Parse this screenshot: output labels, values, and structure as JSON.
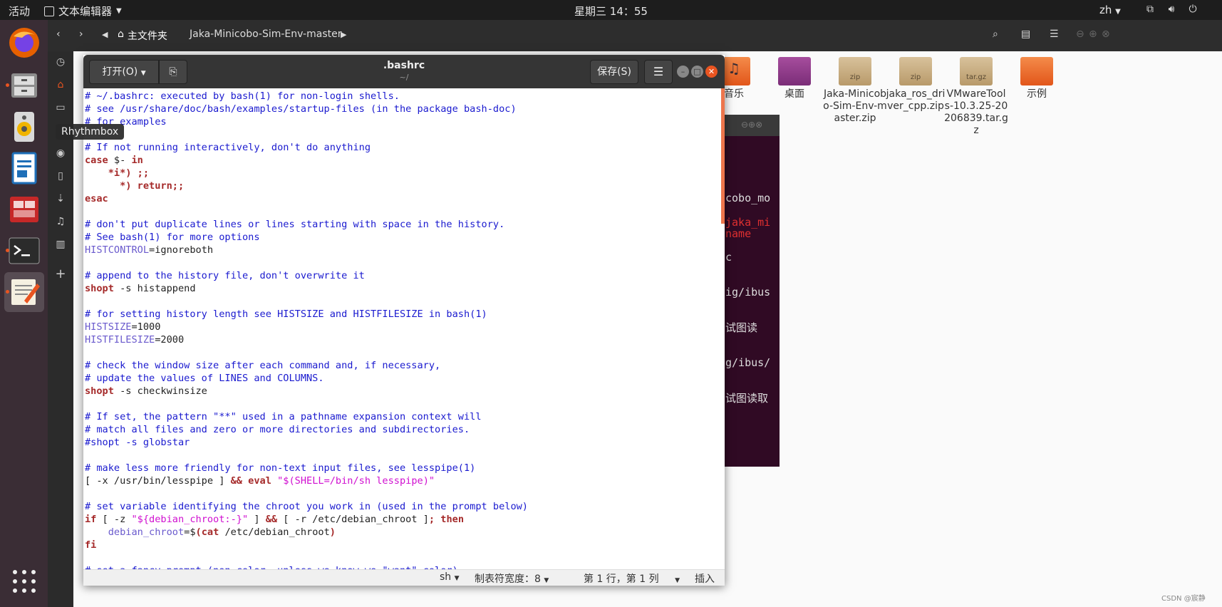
{
  "topbar": {
    "activities": "活动",
    "app_menu": "文本编辑器",
    "clock": "星期三 14：55",
    "lang": "zh"
  },
  "dock": {
    "tooltip": "Rhythmbox"
  },
  "files": {
    "home_label": "主文件夹",
    "path_segment": "Jaka-Minicobo-Sim-Env-master",
    "items": [
      {
        "label": "音乐",
        "icon": "music-folder-icon"
      },
      {
        "label": "桌面",
        "icon": "desktop-folder-icon"
      },
      {
        "label": "Jaka-Minicobo-Sim-Env-master.zip",
        "icon": "zip-icon",
        "badge": "zip"
      },
      {
        "label": "jaka_ros_driver_cpp.zip",
        "icon": "zip-icon",
        "badge": "zip"
      },
      {
        "label": "VMwareTools-10.3.25-20206839.tar.gz",
        "icon": "tar-icon",
        "badge": "tar.gz"
      },
      {
        "label": "示例",
        "icon": "examples-folder-icon"
      }
    ]
  },
  "bg_terminal": {
    "lines": [
      "cobo_mo",
      "jaka_mi",
      "name",
      "c",
      "ig/ibus",
      "试图读",
      "g/ibus/",
      "试图读取"
    ]
  },
  "gedit": {
    "open_label": "打开(O)",
    "title": ".bashrc",
    "subtitle": "~/",
    "save_label": "保存(S)",
    "status": {
      "language": "sh",
      "tab_width": "制表符宽度：8",
      "position": "第 1 行，第 1 列",
      "mode": "插入"
    }
  },
  "code_lines": [
    [
      {
        "t": "# ~/.bashrc: executed by bash(1) for non-login shells.",
        "c": "comment"
      }
    ],
    [
      {
        "t": "# see /usr/share/doc/bash/examples/startup-files (in the package bash-doc)",
        "c": "comment"
      }
    ],
    [
      {
        "t": "# for examples",
        "c": "comment"
      }
    ],
    [],
    [
      {
        "t": "# If not running interactively, don't do anything",
        "c": "comment"
      }
    ],
    [
      {
        "t": "case",
        "c": "kw"
      },
      {
        "t": " $- "
      },
      {
        "t": "in",
        "c": "kw"
      }
    ],
    [
      {
        "t": "    "
      },
      {
        "t": "*i*) ;;",
        "c": "kw"
      }
    ],
    [
      {
        "t": "      "
      },
      {
        "t": "*) return;;",
        "c": "kw"
      }
    ],
    [
      {
        "t": "esac",
        "c": "kw"
      }
    ],
    [],
    [
      {
        "t": "# don't put duplicate lines or lines starting with space in the history.",
        "c": "comment"
      }
    ],
    [
      {
        "t": "# See bash(1) for more options",
        "c": "comment"
      }
    ],
    [
      {
        "t": "HISTCONTROL",
        "c": "var"
      },
      {
        "t": "=ignoreboth"
      }
    ],
    [],
    [
      {
        "t": "# append to the history file, don't overwrite it",
        "c": "comment"
      }
    ],
    [
      {
        "t": "shopt",
        "c": "kw"
      },
      {
        "t": " -s histappend"
      }
    ],
    [],
    [
      {
        "t": "# for setting history length see HISTSIZE and HISTFILESIZE in bash(1)",
        "c": "comment"
      }
    ],
    [
      {
        "t": "HISTSIZE",
        "c": "var"
      },
      {
        "t": "=1000"
      }
    ],
    [
      {
        "t": "HISTFILESIZE",
        "c": "var"
      },
      {
        "t": "=2000"
      }
    ],
    [],
    [
      {
        "t": "# check the window size after each command and, if necessary,",
        "c": "comment"
      }
    ],
    [
      {
        "t": "# update the values of LINES and COLUMNS.",
        "c": "comment"
      }
    ],
    [
      {
        "t": "shopt",
        "c": "kw"
      },
      {
        "t": " -s checkwinsize"
      }
    ],
    [],
    [
      {
        "t": "# If set, the pattern \"**\" used in a pathname expansion context will",
        "c": "comment"
      }
    ],
    [
      {
        "t": "# match all files and zero or more directories and subdirectories.",
        "c": "comment"
      }
    ],
    [
      {
        "t": "#shopt -s globstar",
        "c": "comment"
      }
    ],
    [],
    [
      {
        "t": "# make less more friendly for non-text input files, see lesspipe(1)",
        "c": "comment"
      }
    ],
    [
      {
        "t": "[ -x /usr/bin/lesspipe ] "
      },
      {
        "t": "&& eval",
        "c": "kw"
      },
      {
        "t": " "
      },
      {
        "t": "\"$(SHELL=/bin/sh lesspipe)\"",
        "c": "str"
      }
    ],
    [],
    [
      {
        "t": "# set variable identifying the chroot you work in (used in the prompt below)",
        "c": "comment"
      }
    ],
    [
      {
        "t": "if",
        "c": "kw"
      },
      {
        "t": " [ -z "
      },
      {
        "t": "\"${debian_chroot:-}\"",
        "c": "str"
      },
      {
        "t": " ] "
      },
      {
        "t": "&&",
        "c": "kw"
      },
      {
        "t": " [ -r /etc/debian_chroot ]"
      },
      {
        "t": "; then",
        "c": "kw"
      }
    ],
    [
      {
        "t": "    "
      },
      {
        "t": "debian_chroot",
        "c": "var"
      },
      {
        "t": "=$"
      },
      {
        "t": "(cat",
        "c": "kw"
      },
      {
        "t": " /etc/debian_chroot"
      },
      {
        "t": ")",
        "c": "kw"
      }
    ],
    [
      {
        "t": "fi",
        "c": "kw"
      }
    ],
    [],
    [
      {
        "t": "# set a fancy prompt (non-color, unless we know we \"want\" color)",
        "c": "comment"
      }
    ]
  ],
  "watermark": "CSDN @宸静"
}
